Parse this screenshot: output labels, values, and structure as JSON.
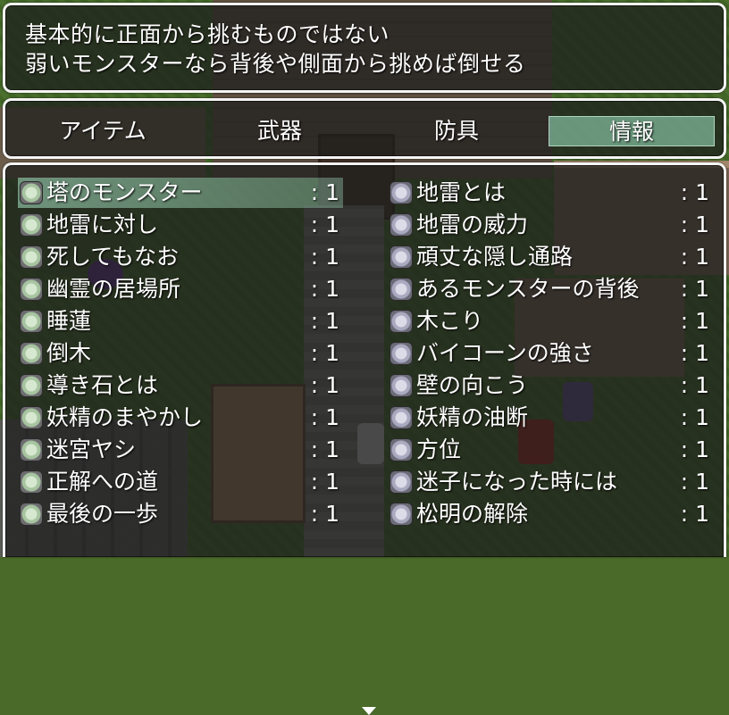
{
  "help": {
    "line1": "基本的に正面から挑むものではない",
    "line2": "弱いモンスターなら背後や側面から挑めば倒せる"
  },
  "categories": [
    {
      "label": "アイテム",
      "selected": false
    },
    {
      "label": "武器",
      "selected": false
    },
    {
      "label": "防具",
      "selected": false
    },
    {
      "label": "情報",
      "selected": true
    }
  ],
  "items_left": [
    {
      "name": "塔のモンスター",
      "count": ": 1",
      "selected": true
    },
    {
      "name": "地雷に対し",
      "count": ": 1"
    },
    {
      "name": "死してもなお",
      "count": ": 1"
    },
    {
      "name": "幽霊の居場所",
      "count": ": 1"
    },
    {
      "name": "睡蓮",
      "count": ": 1"
    },
    {
      "name": "倒木",
      "count": ": 1"
    },
    {
      "name": "導き石とは",
      "count": ": 1"
    },
    {
      "name": "妖精のまやかし",
      "count": ": 1"
    },
    {
      "name": "迷宮ヤシ",
      "count": ": 1"
    },
    {
      "name": "正解への道",
      "count": ": 1"
    },
    {
      "name": "最後の一歩",
      "count": ": 1"
    }
  ],
  "items_right": [
    {
      "name": "地雷とは",
      "count": ": 1"
    },
    {
      "name": "地雷の威力",
      "count": ": 1"
    },
    {
      "name": "頑丈な隠し通路",
      "count": ": 1"
    },
    {
      "name": "あるモンスターの背後",
      "count": ": 1"
    },
    {
      "name": "木こり",
      "count": ": 1"
    },
    {
      "name": "バイコーンの強さ",
      "count": ": 1"
    },
    {
      "name": "壁の向こう",
      "count": ": 1"
    },
    {
      "name": "妖精の油断",
      "count": ": 1"
    },
    {
      "name": "方位",
      "count": ": 1"
    },
    {
      "name": "迷子になった時には",
      "count": ": 1"
    },
    {
      "name": "松明の解除",
      "count": ": 1"
    }
  ],
  "icons": {
    "item": "orb-icon",
    "more": "scroll-down-arrow-icon"
  }
}
